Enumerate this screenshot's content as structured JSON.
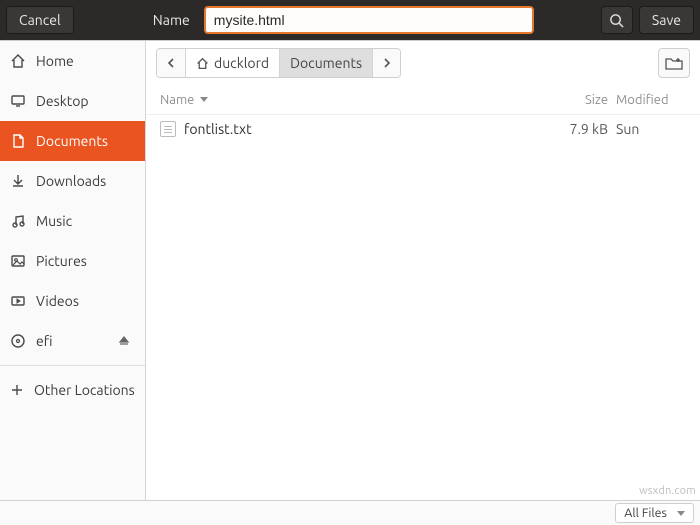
{
  "header": {
    "cancel": "Cancel",
    "name_label": "Name",
    "filename_value": "mysite.html",
    "save": "Save"
  },
  "sidebar": {
    "items": [
      {
        "label": "Home",
        "icon": "home-icon"
      },
      {
        "label": "Desktop",
        "icon": "desktop-icon"
      },
      {
        "label": "Documents",
        "icon": "documents-icon",
        "selected": true
      },
      {
        "label": "Downloads",
        "icon": "downloads-icon"
      },
      {
        "label": "Music",
        "icon": "music-icon"
      },
      {
        "label": "Pictures",
        "icon": "pictures-icon"
      },
      {
        "label": "Videos",
        "icon": "videos-icon"
      },
      {
        "label": "efi",
        "icon": "disk-icon",
        "ejectable": true
      }
    ],
    "other_locations": "Other Locations"
  },
  "path": {
    "segments": [
      {
        "label": "ducklord",
        "icon": "home-icon"
      },
      {
        "label": "Documents",
        "active": true
      }
    ]
  },
  "list": {
    "headers": {
      "name": "Name",
      "size": "Size",
      "modified": "Modified"
    },
    "rows": [
      {
        "name": "fontlist.txt",
        "size": "7.9 kB",
        "modified": "Sun"
      }
    ]
  },
  "footer": {
    "filter": "All Files"
  },
  "watermark": "wsxdn.com"
}
